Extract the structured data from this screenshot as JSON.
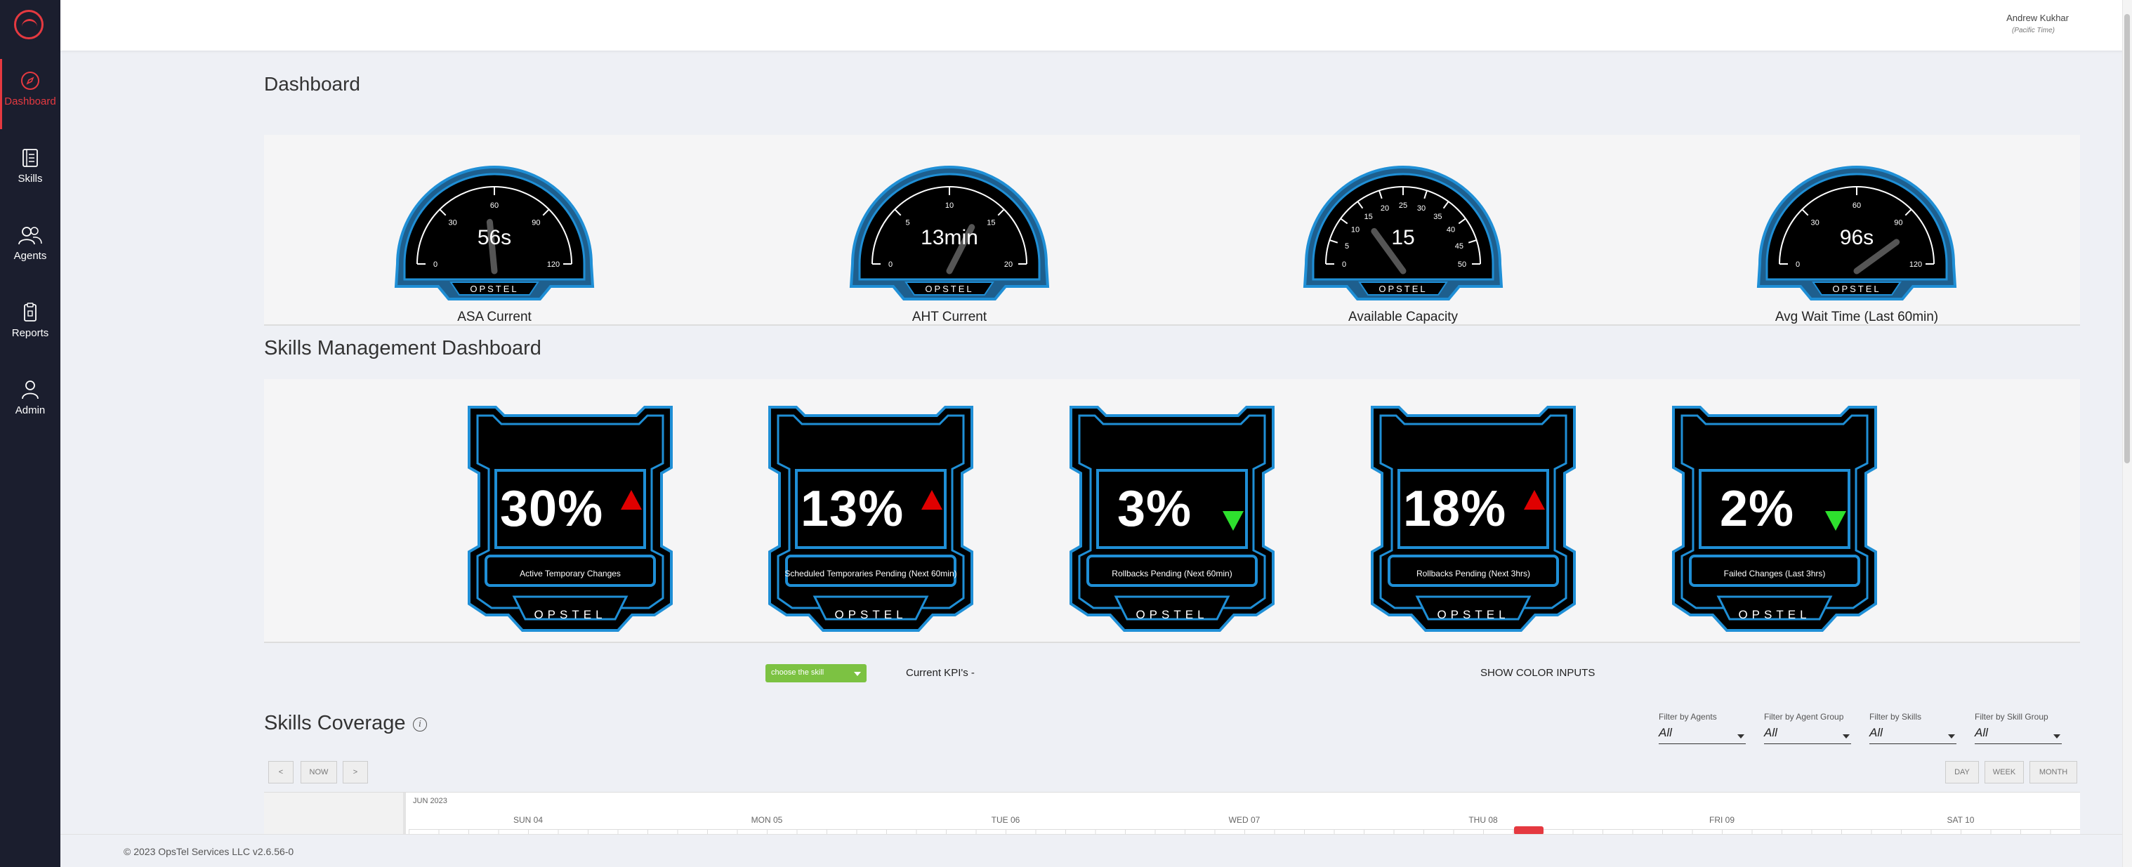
{
  "sidebar": {
    "items": [
      {
        "label": "Dashboard"
      },
      {
        "label": "Skills"
      },
      {
        "label": "Agents"
      },
      {
        "label": "Reports"
      },
      {
        "label": "Admin"
      }
    ]
  },
  "header": {
    "user_name": "Andrew Kukhar",
    "user_timezone": "(Pacific Time)"
  },
  "page_title": "Dashboard",
  "gauges": [
    {
      "label": "ASA Current",
      "value": "56s",
      "ticks": [
        "0",
        "30",
        "60",
        "90",
        "120"
      ],
      "level": 0.47,
      "brand": "OPSTEL"
    },
    {
      "label": "AHT Current",
      "value": "13min",
      "ticks": [
        "0",
        "5",
        "10",
        "15",
        "20"
      ],
      "level": 0.65,
      "brand": "OPSTEL"
    },
    {
      "label": "Available Capacity",
      "value": "15",
      "ticks": [
        "0",
        "5",
        "10",
        "15",
        "20",
        "25",
        "30",
        "35",
        "40",
        "45",
        "50"
      ],
      "level": 0.3,
      "brand": "OPSTEL"
    },
    {
      "label": "Avg Wait Time (Last 60min)",
      "value": "96s",
      "ticks": [
        "0",
        "30",
        "60",
        "90",
        "120"
      ],
      "level": 0.8,
      "brand": "OPSTEL"
    }
  ],
  "skills_section_title": "Skills Management Dashboard",
  "kpis": [
    {
      "value": "30%",
      "label": "Active Temporary Changes",
      "trend": "up",
      "brand": "OPSTEL"
    },
    {
      "value": "13%",
      "label": "Scheduled Temporaries Pending (Next 60min)",
      "trend": "up",
      "brand": "OPSTEL"
    },
    {
      "value": "3%",
      "label": "Rollbacks Pending (Next 60min)",
      "trend": "down",
      "brand": "OPSTEL"
    },
    {
      "value": "18%",
      "label": "Rollbacks Pending (Next 3hrs)",
      "trend": "up",
      "brand": "OPSTEL"
    },
    {
      "value": "2%",
      "label": "Failed Changes (Last 3hrs)",
      "trend": "down",
      "brand": "OPSTEL"
    }
  ],
  "controls": {
    "skill_select": "choose the skill",
    "current_kpis": "Current KPI's -",
    "show_color_inputs": "SHOW COLOR INPUTS"
  },
  "coverage": {
    "title": "Skills Coverage",
    "info_icon": "i",
    "filters": [
      {
        "label": "Filter by Agents",
        "value": "All"
      },
      {
        "label": "Filter by Agent Group",
        "value": "All"
      },
      {
        "label": "Filter by Skills",
        "value": "All"
      },
      {
        "label": "Filter by Skill Group",
        "value": "All"
      }
    ],
    "nav_buttons": [
      "<",
      "NOW",
      ">"
    ],
    "view_buttons": [
      "DAY",
      "WEEK",
      "MONTH"
    ],
    "month": "JUN 2023",
    "days": [
      "SUN 04",
      "MON 05",
      "TUE 06",
      "WED 07",
      "THU 08",
      "FRI 09",
      "SAT 10"
    ]
  },
  "footer": "© 2023 OpsTel Services LLC v2.6.56-0",
  "colors": {
    "sidebar_bg": "#1b1e2e",
    "accent": "#e53940",
    "gauge_ring": "#1f8fd6",
    "trend_up": "#e00000",
    "trend_down": "#2ee02e",
    "select_green": "#7cc242"
  }
}
